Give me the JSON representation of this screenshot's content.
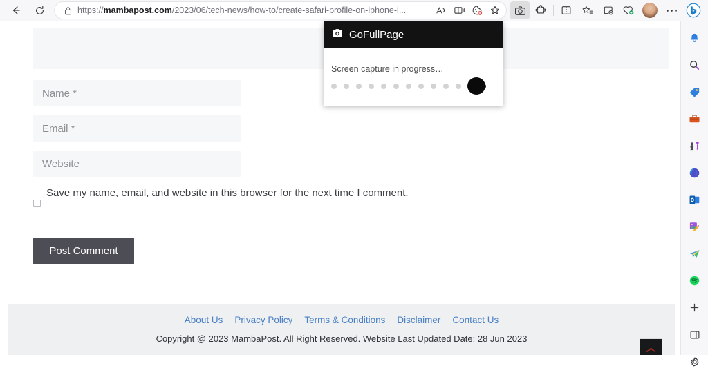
{
  "browser": {
    "back_label": "Back",
    "refresh_label": "Refresh",
    "url_prefix": "https://",
    "url_domain": "mambapost.com",
    "url_path": "/2023/06/tech-news/how-to/create-safari-profile-on-iphone-i...",
    "lock_icon": "lock-icon",
    "omnibox_icons": [
      {
        "name": "read-aloud-icon",
        "label": "Read aloud"
      },
      {
        "name": "immersive-reader-icon",
        "label": "Enter Immersive Reader"
      },
      {
        "name": "shopping-cookie-icon",
        "label": "Shopping"
      },
      {
        "name": "favorite-star-icon",
        "label": "Add this page to favorites"
      }
    ],
    "toolbar_icons": [
      {
        "name": "screenshot-camera-icon",
        "label": "GoFullPage - Full Page Screen Capture",
        "active": true
      },
      {
        "name": "extensions-puzzle-icon",
        "label": "Extensions"
      },
      {
        "name": "split-screen-icon",
        "label": "Split screen"
      },
      {
        "name": "favorites-icon",
        "label": "Favorites"
      },
      {
        "name": "collections-icon",
        "label": "Collections"
      },
      {
        "name": "browser-essentials-icon",
        "label": "Browser essentials"
      },
      {
        "name": "profile-avatar",
        "label": "Profile"
      },
      {
        "name": "settings-more-icon",
        "label": "Settings and more"
      },
      {
        "name": "copilot-bing-icon",
        "label": "Copilot"
      }
    ]
  },
  "gofullpage": {
    "title": "GoFullPage",
    "camera_icon": "camera-icon",
    "status": "Screen capture in progress…",
    "dots_total": 13,
    "dots_filled": 1,
    "header_bg": "#121212"
  },
  "page": {
    "comment_textarea": {
      "name": "comment-textarea",
      "value": "",
      "placeholder": ""
    },
    "fields": [
      {
        "name": "name-input",
        "placeholder": "Name *",
        "value": ""
      },
      {
        "name": "email-input",
        "placeholder": "Email *",
        "value": ""
      },
      {
        "name": "website-input",
        "placeholder": "Website",
        "value": ""
      }
    ],
    "consent": {
      "checked": false,
      "label": "Save my name, email, and website in this browser for the next time I comment."
    },
    "submit_label": "Post Comment",
    "footer": {
      "links": [
        "About Us",
        "Privacy Policy",
        "Terms & Conditions",
        "Disclaimer",
        "Contact Us"
      ],
      "copyright": "Copyright @ 2023 MambaPost. All Right Reserved. Website Last Updated Date: 28 Jun 2023",
      "link_color": "#4a80c4"
    },
    "scroll_top": {
      "name": "scroll-to-top-button",
      "icon": "chevron-up-icon",
      "color": "#c0392b"
    }
  },
  "sidebar": {
    "items": [
      {
        "name": "sidebar-notifications-icon",
        "label": "Notifications"
      },
      {
        "name": "sidebar-search-icon",
        "label": "Search"
      },
      {
        "name": "sidebar-shopping-tag-icon",
        "label": "Shopping"
      },
      {
        "name": "sidebar-tools-icon",
        "label": "Tools"
      },
      {
        "name": "sidebar-games-icon",
        "label": "Games"
      },
      {
        "name": "sidebar-office-icon",
        "label": "Microsoft 365"
      },
      {
        "name": "sidebar-outlook-icon",
        "label": "Outlook"
      },
      {
        "name": "sidebar-designer-icon",
        "label": "Image Creator"
      },
      {
        "name": "sidebar-telegram-icon",
        "label": "Telegram"
      },
      {
        "name": "sidebar-spotify-icon",
        "label": "Spotify"
      },
      {
        "name": "sidebar-add-icon",
        "label": "Customize"
      }
    ],
    "bottom_items": [
      {
        "name": "sidebar-toggle-panel-icon",
        "label": "Toggle sidebar"
      },
      {
        "name": "sidebar-settings-gear-icon",
        "label": "Sidebar settings"
      }
    ]
  }
}
